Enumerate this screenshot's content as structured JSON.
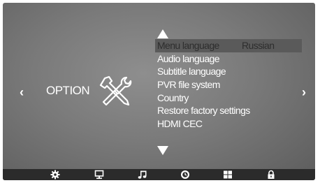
{
  "nav": {
    "left_arrow": "‹",
    "right_arrow": "›"
  },
  "section": {
    "title": "OPTION",
    "icon": "tools-icon"
  },
  "menu": {
    "items": [
      {
        "label": "Menu language",
        "value": "Russian",
        "selected": true
      },
      {
        "label": "Audio language"
      },
      {
        "label": "Subtitle language"
      },
      {
        "label": "PVR file system"
      },
      {
        "label": "Country"
      },
      {
        "label": "Restore factory settings"
      },
      {
        "label": "HDMI CEC"
      }
    ]
  },
  "bottom_bar": {
    "icons": [
      "gear-icon",
      "monitor-icon",
      "music-note-icon",
      "clock-icon",
      "grid-icon",
      "lock-icon"
    ],
    "active": "clock-icon"
  },
  "colors": {
    "text": "#ffffff",
    "highlight_bg": "#5a5a5a",
    "highlight_text": "#2e2e2e",
    "bar_bg": "#2b2b2b"
  }
}
